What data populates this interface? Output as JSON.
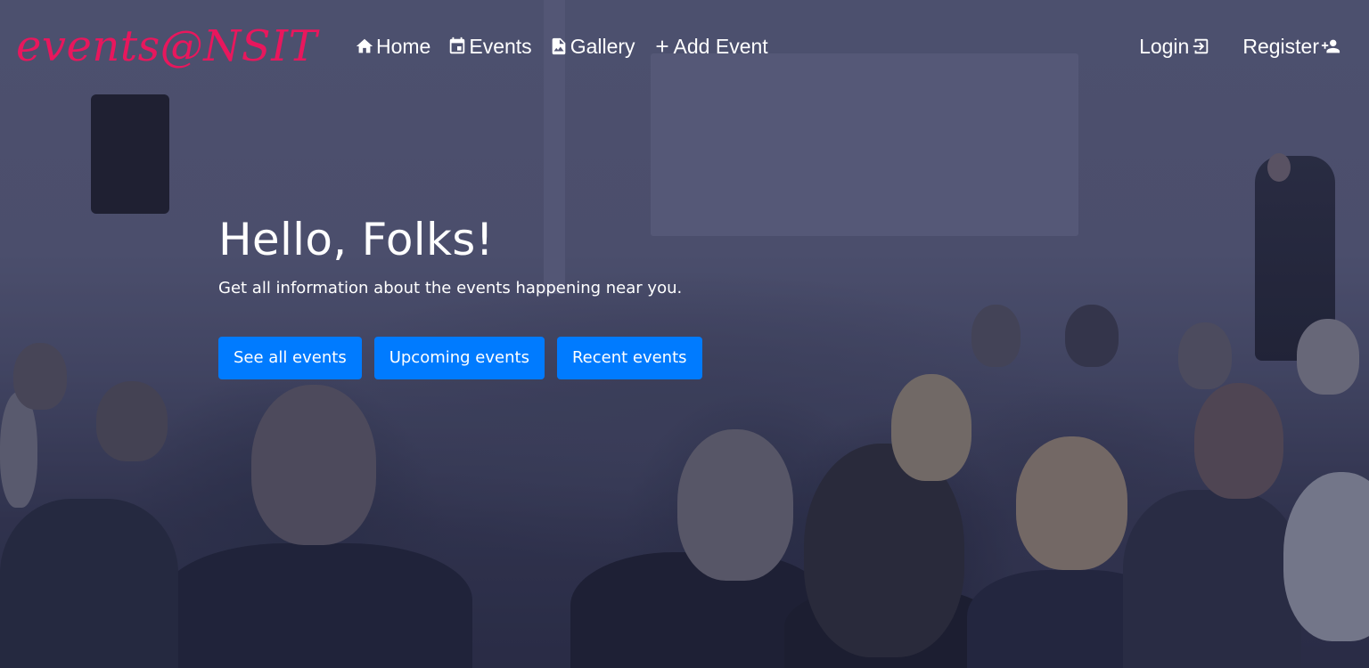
{
  "brand": {
    "logo_text": "events@NSIT"
  },
  "nav": {
    "items": [
      {
        "label": "Home",
        "icon": "home-icon"
      },
      {
        "label": "Events",
        "icon": "calendar-icon"
      },
      {
        "label": "Gallery",
        "icon": "image-file-icon"
      },
      {
        "label": "Add Event",
        "icon": "plus-icon"
      }
    ],
    "right": [
      {
        "label": "Login",
        "icon": "login-icon"
      },
      {
        "label": "Register",
        "icon": "add-user-icon"
      }
    ]
  },
  "hero": {
    "title": "Hello, Folks!",
    "subtitle": "Get all information about the events happening near you.",
    "buttons": [
      {
        "label": "See all events"
      },
      {
        "label": "Upcoming events"
      },
      {
        "label": "Recent events"
      }
    ]
  },
  "colors": {
    "brand": "#e8175d",
    "button": "#007bff",
    "background_overlay": "#4b4e6c",
    "text": "#ffffff"
  }
}
